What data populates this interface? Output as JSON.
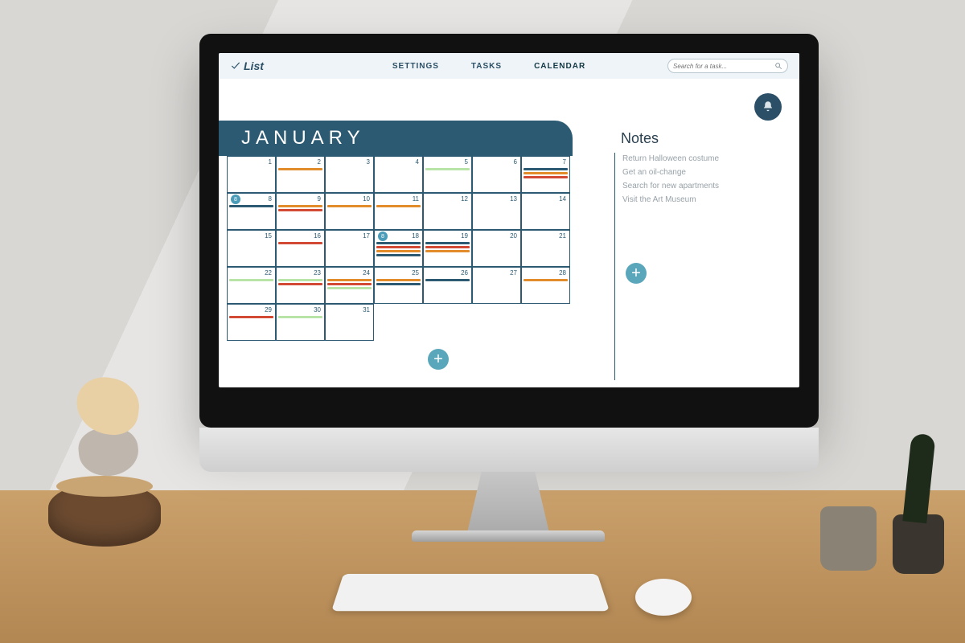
{
  "brand": {
    "name": "List"
  },
  "nav": {
    "settings": "SETTINGS",
    "tasks": "TASKS",
    "calendar": "CALENDAR"
  },
  "search": {
    "placeholder": "Search for a task..."
  },
  "calendar": {
    "month": "JANUARY",
    "days": [
      {
        "n": 1,
        "bars": []
      },
      {
        "n": 2,
        "bars": [
          "orange"
        ]
      },
      {
        "n": 3,
        "bars": []
      },
      {
        "n": 4,
        "bars": []
      },
      {
        "n": 5,
        "bars": [
          "green"
        ]
      },
      {
        "n": 6,
        "bars": []
      },
      {
        "n": 7,
        "bars": [
          "blue",
          "orange",
          "red"
        ]
      },
      {
        "n": 8,
        "bars": [
          "blue"
        ],
        "circle": "8"
      },
      {
        "n": 9,
        "bars": [
          "orange",
          "red"
        ]
      },
      {
        "n": 10,
        "bars": [
          "orange"
        ]
      },
      {
        "n": 11,
        "bars": [
          "orange"
        ]
      },
      {
        "n": 12,
        "bars": []
      },
      {
        "n": 13,
        "bars": []
      },
      {
        "n": 14,
        "bars": []
      },
      {
        "n": 15,
        "bars": []
      },
      {
        "n": 16,
        "bars": [
          "red"
        ]
      },
      {
        "n": 17,
        "bars": []
      },
      {
        "n": 18,
        "bars": [
          "blue",
          "red",
          "orange",
          "blue"
        ],
        "circle": "8"
      },
      {
        "n": 19,
        "bars": [
          "blue",
          "red",
          "orange"
        ]
      },
      {
        "n": 20,
        "bars": []
      },
      {
        "n": 21,
        "bars": []
      },
      {
        "n": 22,
        "bars": [
          "green"
        ]
      },
      {
        "n": 23,
        "bars": [
          "green",
          "red"
        ]
      },
      {
        "n": 24,
        "bars": [
          "orange",
          "red",
          "green"
        ]
      },
      {
        "n": 25,
        "bars": [
          "orange",
          "blue"
        ]
      },
      {
        "n": 26,
        "bars": [
          "blue"
        ]
      },
      {
        "n": 27,
        "bars": []
      },
      {
        "n": 28,
        "bars": [
          "orange"
        ]
      },
      {
        "n": 29,
        "bars": [
          "red"
        ]
      },
      {
        "n": 30,
        "bars": [
          "green"
        ]
      },
      {
        "n": 31,
        "bars": []
      }
    ]
  },
  "notes": {
    "title": "Notes",
    "items": [
      "Return Halloween costume",
      "Get an oil-change",
      "Search for new apartments",
      "Visit the Art Museum"
    ]
  },
  "colors": {
    "blue": "#2b5a72",
    "orange": "#e28c2b",
    "red": "#d24a33",
    "green": "#b9e4a8",
    "accent": "#5aa6bb"
  }
}
